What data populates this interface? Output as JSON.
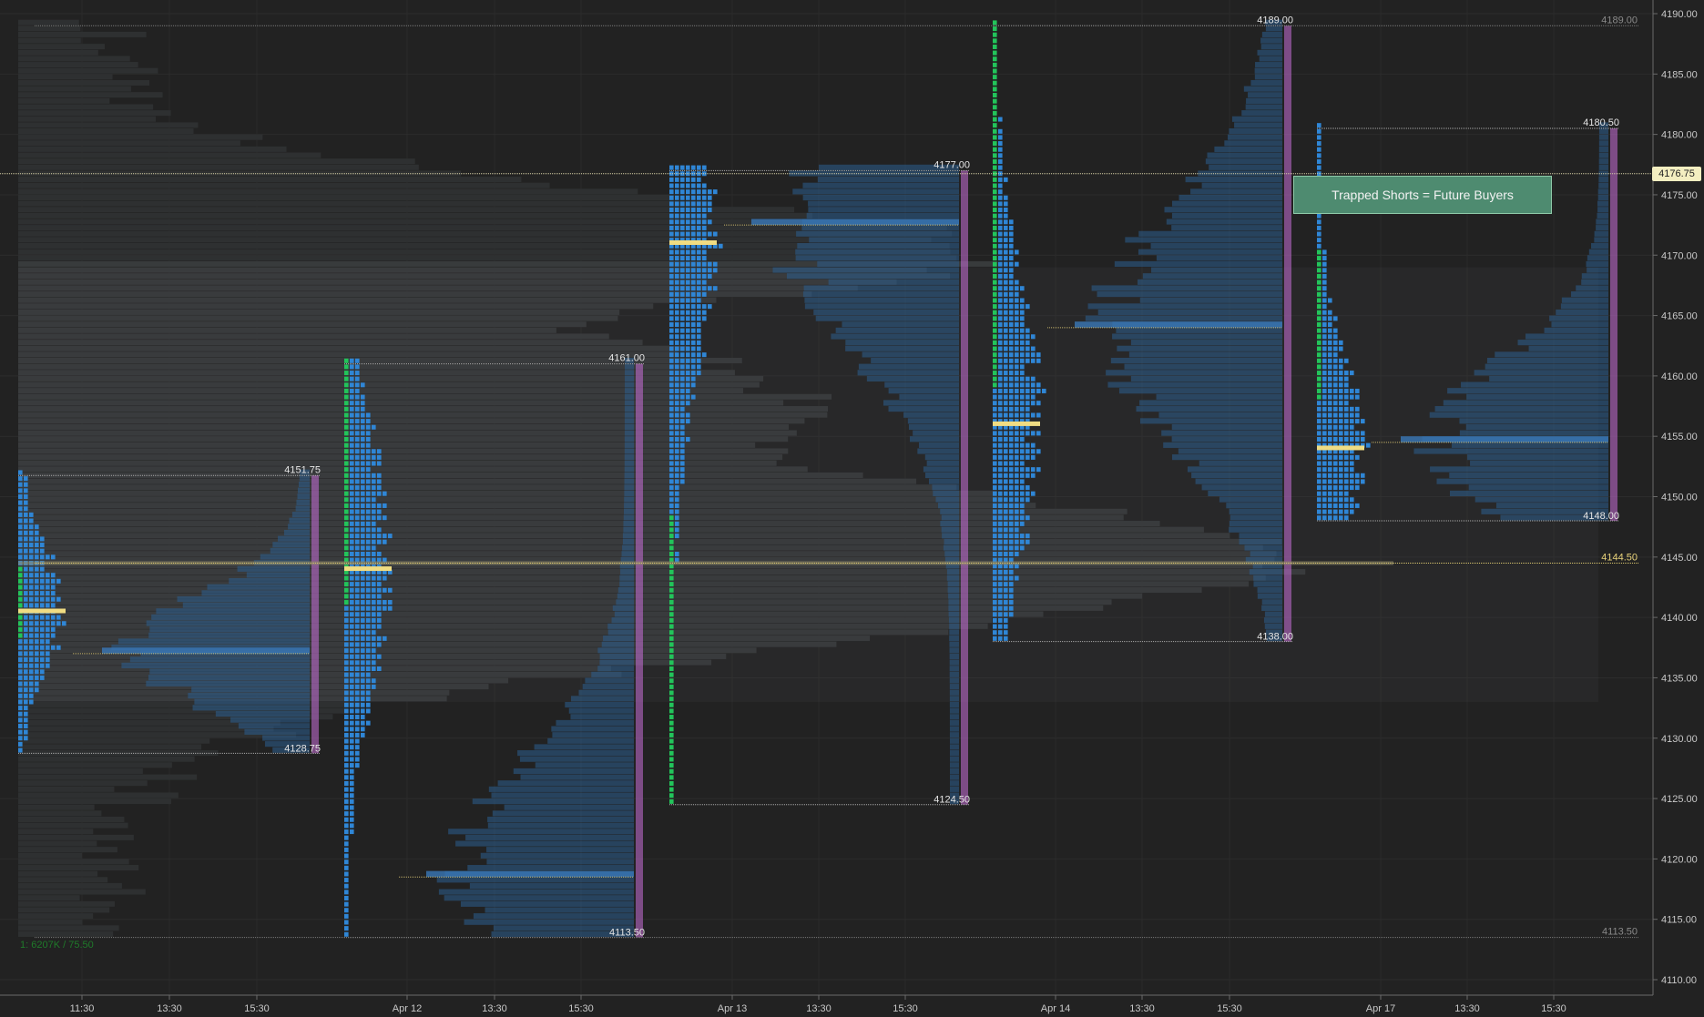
{
  "chart_data": {
    "type": "market-profile",
    "price_axis": {
      "ylim": [
        4108,
        4191
      ],
      "ticks": [
        "4190.00",
        "4185.00",
        "4180.00",
        "4175.00",
        "4170.00",
        "4165.00",
        "4160.00",
        "4155.00",
        "4150.00",
        "4145.00",
        "4140.00",
        "4135.00",
        "4130.00",
        "4125.00",
        "4120.00",
        "4115.00",
        "4110.00"
      ]
    },
    "time_axis": {
      "ticks": [
        "11:30",
        "13:30",
        "15:30",
        "Apr 12",
        "13:30",
        "15:30",
        "Apr 13",
        "13:30",
        "15:30",
        "Apr 14",
        "13:30",
        "15:30",
        "Apr 17",
        "13:30",
        "15:30"
      ]
    },
    "current_price": "4176.75",
    "callout": "Trapped Shorts = Future Buyers",
    "footer_note": "1: 6207K / 75.50",
    "sessions": [
      {
        "high": 4151.75,
        "low": 4128.75,
        "poc": 4140.5,
        "vpoc": 4137.0,
        "high_label": "4151.75",
        "low_label": "4128.75",
        "green_from": 4138.0,
        "green_to": 4144.0
      },
      {
        "high": 4161.0,
        "low": 4113.5,
        "poc": 4144.0,
        "vpoc": 4118.5,
        "high_label": "4161.00",
        "low_label": "4113.50",
        "green_from": 4141.0,
        "green_to": 4161.0
      },
      {
        "high": 4177.0,
        "low": 4124.5,
        "poc": 4171.0,
        "vpoc": 4172.5,
        "high_label": "4177.00",
        "low_label": "4124.50",
        "green_from": 4124.5,
        "green_to": 4148.0
      },
      {
        "high": 4189.0,
        "low": 4138.0,
        "poc": 4156.0,
        "vpoc": 4164.0,
        "high_label": "4189.00",
        "low_label": "4138.00",
        "green_from": 4159.0,
        "green_to": 4189.0
      },
      {
        "high": 4180.5,
        "low": 4148.0,
        "poc": 4154.0,
        "vpoc": 4154.5,
        "high_label": "4180.50",
        "low_label": "4148.00",
        "green_from": 4158.0,
        "green_to": 4170.0
      }
    ],
    "composite_levels": [
      {
        "price": 4189.0,
        "label": "4189.00"
      },
      {
        "price": 4113.5,
        "label": "4113.50"
      },
      {
        "price": 4144.5,
        "label": "4144.50"
      }
    ],
    "colors": {
      "background": "#222222",
      "profile_blue": "#2f86d6",
      "profile_green": "#22c45a",
      "poc_yellow": "#f0dc82",
      "volume_labels": "#c86fd8",
      "composite": "#3a3d3e",
      "composite_vpoc": "#8f8a6a",
      "callout": "#4e8b70"
    }
  }
}
